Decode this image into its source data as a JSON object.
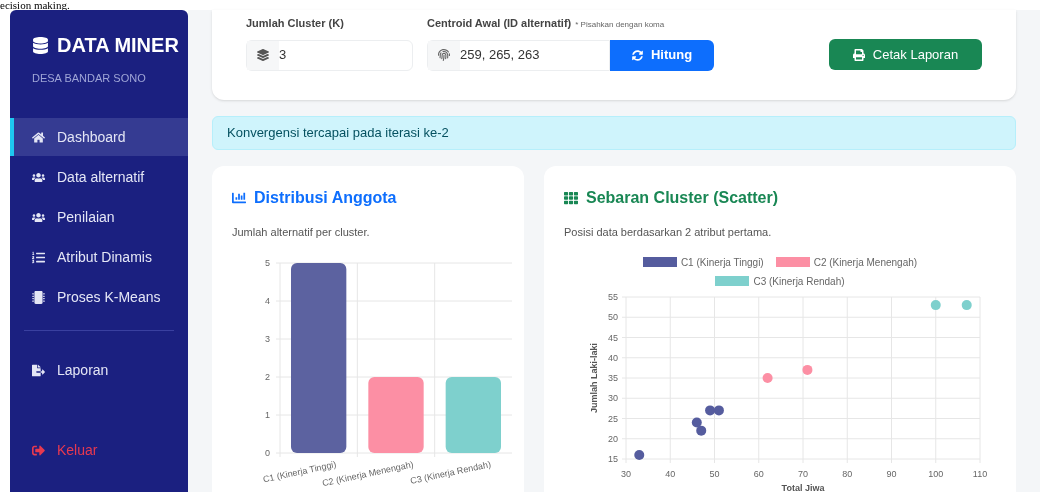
{
  "top_text": "ecision making.",
  "sidebar": {
    "brand": "DATA MINER",
    "subtitle": "DESA BANDAR SONO",
    "items": [
      {
        "label": "Dashboard",
        "selected": true
      },
      {
        "label": "Data alternatif",
        "selected": false
      },
      {
        "label": "Penilaian",
        "selected": false
      },
      {
        "label": "Atribut Dinamis",
        "selected": false
      },
      {
        "label": "Proses K-Means",
        "selected": false
      }
    ],
    "report_items": [
      {
        "label": "Laporan",
        "selected": false
      }
    ],
    "logout": "Keluar"
  },
  "form": {
    "k_label": "Jumlah Cluster (K)",
    "k_value": "3",
    "centroid_label": "Centroid Awal (ID alternatif)",
    "centroid_hint": "* Pisahkan dengan koma",
    "centroid_value": "259, 265, 263",
    "compute_button": "Hitung",
    "print_button": "Cetak Laporan"
  },
  "alert": "Konvergensi tercapai pada iterasi ke-2",
  "distribution": {
    "title": "Distribusi Anggota",
    "subtitle": "Jumlah alternatif per cluster.",
    "chart_data": {
      "type": "bar",
      "grid": true,
      "categories": [
        "C1 (Kinerja Tinggi)",
        "C2 (Kinerja Menengah)",
        "C3 (Kinerja Rendah)"
      ],
      "values": [
        5,
        2,
        2
      ],
      "colors": [
        "#5c62a0",
        "#fc8fa4",
        "#7ed0cd"
      ],
      "ylim": [
        0,
        5
      ],
      "yticks": [
        0,
        1,
        2,
        3,
        4,
        5
      ]
    }
  },
  "scatter": {
    "title": "Sebaran Cluster (Scatter)",
    "subtitle": "Posisi data berdasarkan 2 atribut pertama.",
    "chart_data": {
      "type": "scatter",
      "grid": true,
      "legend": "top",
      "xlabel": "Total Jiwa",
      "ylabel": "Jumlah Laki-laki",
      "xlim": [
        30,
        110
      ],
      "ylim": [
        15,
        55
      ],
      "xticks": [
        30,
        40,
        50,
        60,
        70,
        80,
        90,
        100,
        110
      ],
      "yticks": [
        15,
        20,
        25,
        30,
        35,
        40,
        45,
        50,
        55
      ],
      "series": [
        {
          "name": "C1 (Kinerja Tinggi)",
          "color": "#555c9e",
          "x": [
            33,
            46,
            47,
            49,
            51
          ],
          "values": [
            16,
            24,
            22,
            27,
            27
          ]
        },
        {
          "name": "C2 (Kinerja Menengah)",
          "color": "#fc8fa4",
          "x": [
            62,
            71
          ],
          "values": [
            35,
            37
          ]
        },
        {
          "name": "C3 (Kinerja Rendah)",
          "color": "#7ed0cd",
          "x": [
            100,
            107
          ],
          "values": [
            53,
            53
          ]
        }
      ]
    }
  }
}
